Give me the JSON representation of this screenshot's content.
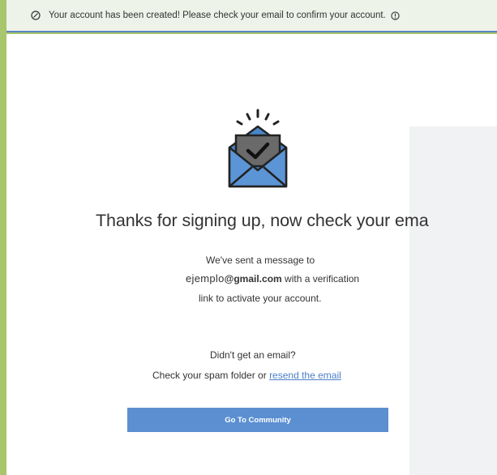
{
  "banner": {
    "message": "Your account has been created! Please check your email to confirm your account."
  },
  "main": {
    "heading": "Thanks for signing up, now check your ema",
    "sent_prefix": "We've sent a message to",
    "email_user": "ejemplo",
    "email_domain": "@gmail.com",
    "sent_suffix": " with a verification",
    "sent_line3": "link to activate your account.",
    "didnt_get": "Didn't get an email?",
    "spam_prefix": "Check your spam folder or ",
    "resend_link": "resend the email",
    "button_label": "Go To Community"
  },
  "colors": {
    "accent": "#5b8fd1",
    "link": "#4a7fc8",
    "outer_background": "#a8c66c",
    "banner_background": "#edf3e8"
  },
  "icons": [
    "check-circle-icon",
    "info-icon",
    "envelope-check-icon"
  ]
}
